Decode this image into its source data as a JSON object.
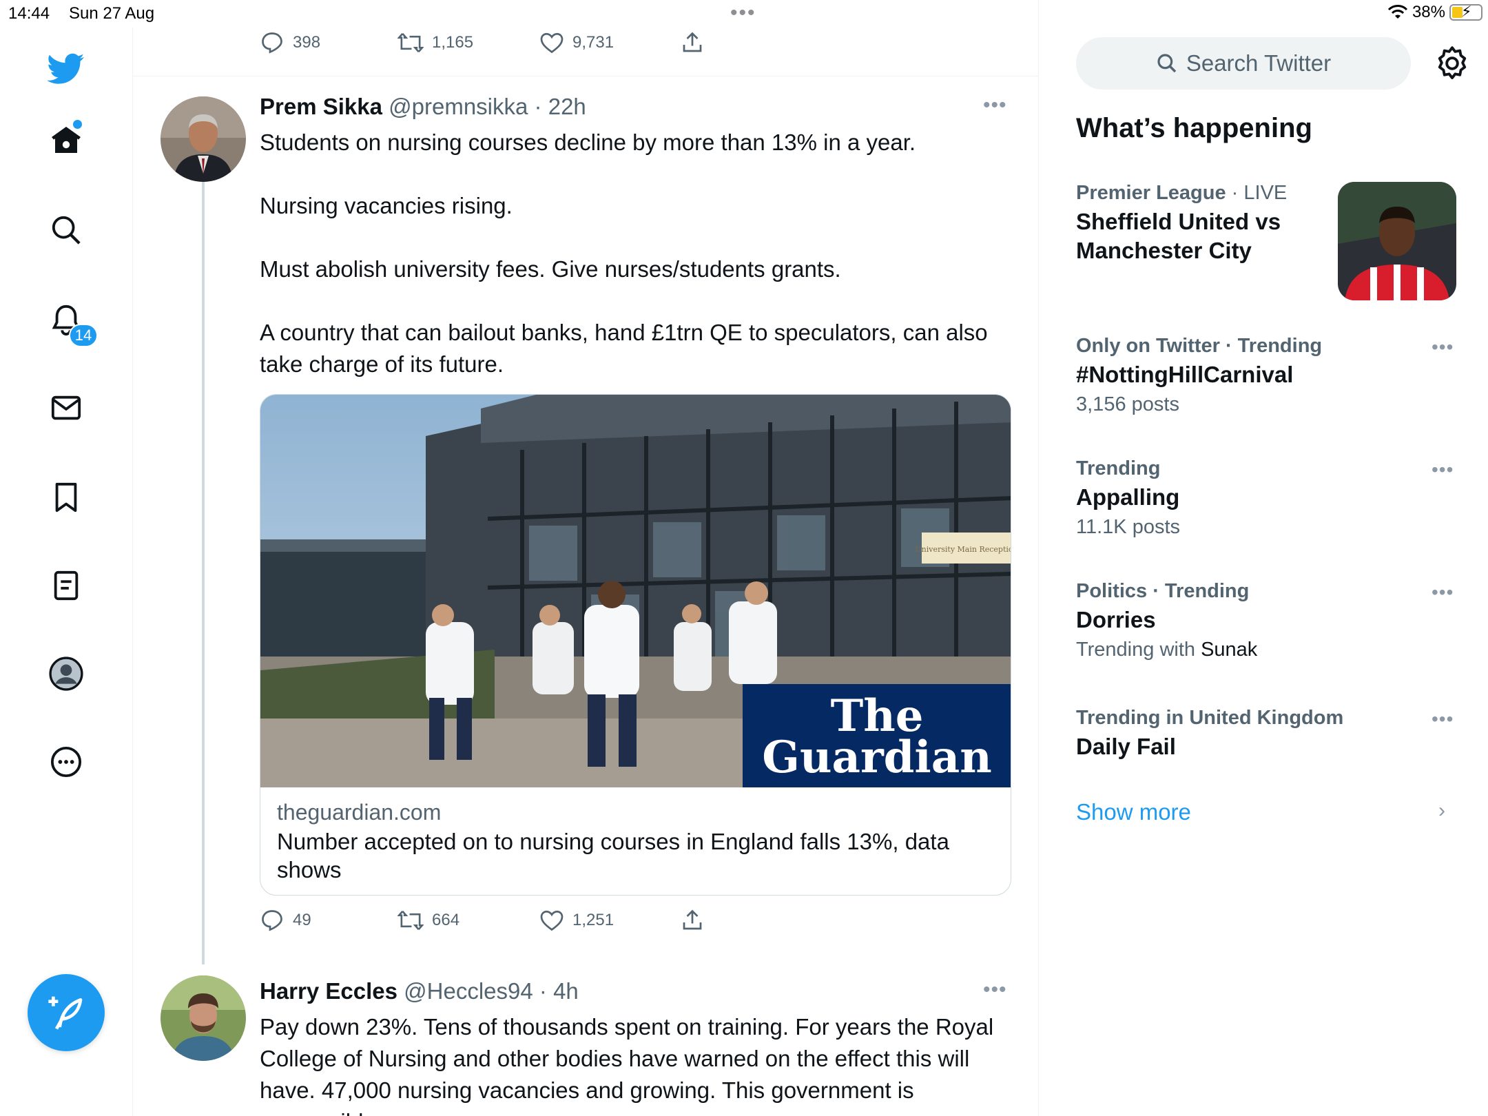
{
  "status_bar": {
    "time": "14:44",
    "date": "Sun 27 Aug",
    "battery": "38%",
    "battery_level": 0.38
  },
  "nav": {
    "items": [
      "twitter-logo",
      "home",
      "explore",
      "notifications",
      "messages",
      "bookmarks",
      "lists",
      "profile",
      "more"
    ],
    "notifications_badge": "14"
  },
  "prev_tweet_actions": {
    "replies": "398",
    "retweets": "1,165",
    "likes": "9,731"
  },
  "tweet1": {
    "name": "Prem Sikka",
    "handle": "@premnsikka",
    "separator": "·",
    "time": "22h",
    "paragraphs": [
      "Students on nursing courses decline by more than 13% in a year.",
      "Nursing vacancies rising.",
      "Must abolish university fees. Give nurses/students grants.",
      "A country that can bailout banks, hand £1trn QE to speculators, can also take charge of its future."
    ],
    "card": {
      "image_overlay_line1": "The",
      "image_overlay_line2": "Guardian",
      "sign_text": "University Main Reception",
      "domain": "theguardian.com",
      "title": "Number accepted on to nursing courses in England falls 13%, data shows"
    },
    "actions": {
      "replies": "49",
      "retweets": "664",
      "likes": "1,251"
    }
  },
  "tweet2": {
    "name": "Harry Eccles",
    "handle": "@Heccles94",
    "separator": "·",
    "time": "4h",
    "text": "Pay down 23%. Tens of thousands spent on training. For years the Royal College of Nursing and other bodies have warned on the effect this will have. 47,000 nursing vacancies and growing. This government is responsible."
  },
  "sidebar": {
    "search_placeholder": "Search Twitter",
    "section_title": "What’s happening",
    "trends": [
      {
        "context_bold": "Premier League",
        "context_rest": " · LIVE",
        "topic": "Sheffield United vs Manchester City",
        "sub": ""
      },
      {
        "context_bold": "Only on Twitter · Trending",
        "context_rest": "",
        "topic": "#NottingHillCarnival",
        "sub": "3,156 posts"
      },
      {
        "context_bold": "Trending",
        "context_rest": "",
        "topic": "Appalling",
        "sub": "11.1K posts"
      },
      {
        "context_bold": "Politics · Trending",
        "context_rest": "",
        "topic": "Dorries",
        "sub_prefix": "Trending with ",
        "sub_name": "Sunak"
      },
      {
        "context_bold": "Trending in United Kingdom",
        "context_rest": "",
        "topic": "Daily Fail",
        "sub": ""
      }
    ],
    "show_more": "Show more"
  },
  "colors": {
    "accent": "#1d9bf0",
    "text_primary": "#0f1419",
    "text_secondary": "#536471",
    "guardian_blue": "#052962"
  }
}
